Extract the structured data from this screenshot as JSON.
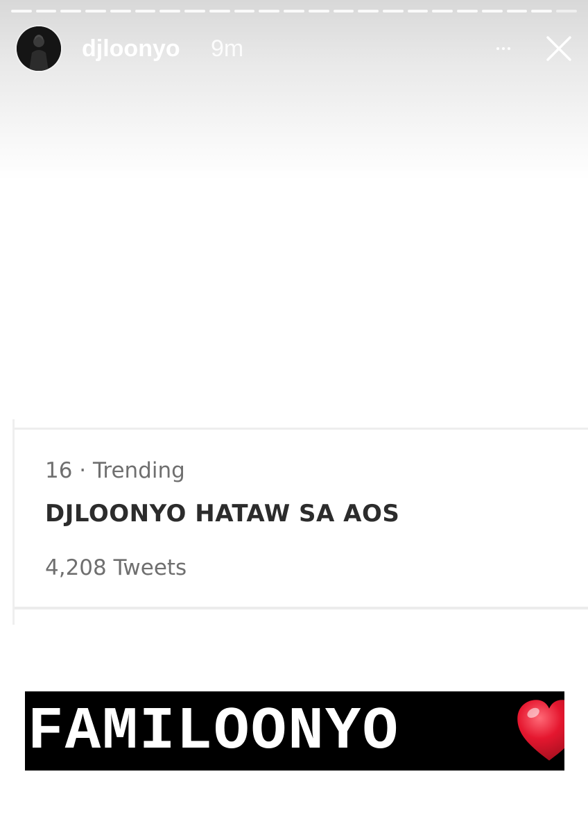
{
  "story": {
    "username": "djloonyo",
    "time_ago": "9m",
    "progress_segments": 23,
    "icons": {
      "avatar": "profile-photo",
      "more": "more-horizontal-icon",
      "close": "close-icon",
      "heart": "red-heart-emoji"
    }
  },
  "trend": {
    "meta": "16 · Trending",
    "title": "DJLOONYO HATAW SA AOS",
    "count": "4,208 Tweets"
  },
  "caption": {
    "text": "FAMILOONYO"
  },
  "colors": {
    "heart": "#e5172f",
    "caption_bg": "#000000",
    "caption_text": "#ffffff",
    "meta_text": "#6f6f6f",
    "title_text": "#2c2c2c"
  }
}
